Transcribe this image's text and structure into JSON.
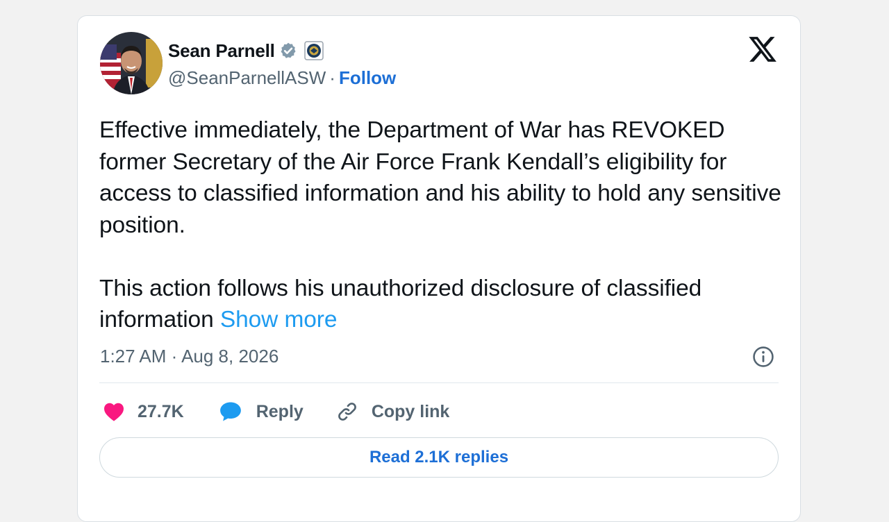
{
  "author": {
    "name": "Sean Parnell",
    "handle": "@SeanParnellASW",
    "separator": "·",
    "follow_label": "Follow"
  },
  "tweet": {
    "paragraph1": "Effective immediately, the Department of War has REVOKED former Secretary of the Air Force Frank Kendall’s eligibility for access to classified information and his ability to hold any sensitive position.",
    "paragraph2": "This action follows his unauthorized disclosure of classified information",
    "show_more_label": "Show more",
    "timestamp": "1:27 AM · Aug 8, 2026"
  },
  "actions": {
    "likes": "27.7K",
    "reply_label": "Reply",
    "copy_link_label": "Copy link"
  },
  "read_replies_label": "Read 2.1K replies",
  "icons": {
    "verified": "verified-badge-icon",
    "affiliation": "affiliation-badge-icon",
    "logo": "x-logo-icon",
    "info": "info-icon",
    "like": "heart-icon",
    "reply": "speech-bubble-icon",
    "copy": "link-icon"
  },
  "colors": {
    "link": "#1d6fd6",
    "show_more": "#1d9bf0",
    "heart": "#f91880",
    "reply_bubble": "#1d9bf0",
    "text": "#0f1419",
    "secondary": "#536471"
  }
}
